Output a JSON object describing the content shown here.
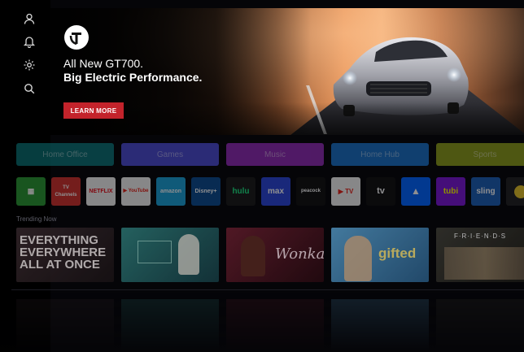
{
  "sidebar": {
    "icons": [
      "user-icon",
      "bell-icon",
      "gear-icon",
      "search-icon"
    ]
  },
  "hero": {
    "headline": "All New GT700.",
    "subheadline": "Big Electric Performance.",
    "cta_label": "LEARN MORE",
    "brand": "GT"
  },
  "categories": [
    {
      "label": "Home Office",
      "color": "#0b6f74"
    },
    {
      "label": "Games",
      "color": "#4b4ad1"
    },
    {
      "label": "Music",
      "color": "#8e2bb3"
    },
    {
      "label": "Home Hub",
      "color": "#1a6fc4"
    },
    {
      "label": "Sports",
      "color": "#8a9a1b"
    }
  ],
  "apps": [
    {
      "label": "▦",
      "name": "apps",
      "color": "#2f9b3a"
    },
    {
      "label": "TV Channels",
      "name": "watchfree",
      "color": "#d0312d"
    },
    {
      "label": "NETFLIX",
      "name": "netflix",
      "color": "#ffffff"
    },
    {
      "label": "▶ YouTube",
      "name": "youtube",
      "color": "#ffffff"
    },
    {
      "label": "amazon",
      "name": "prime-video",
      "color": "#1aa1d6"
    },
    {
      "label": "Disney+",
      "name": "disney-plus",
      "color": "#0b4b8f"
    },
    {
      "label": "hulu",
      "name": "hulu",
      "color": "#1ce783"
    },
    {
      "label": "max",
      "name": "max",
      "color": "#2a46d8"
    },
    {
      "label": "peacock",
      "name": "peacock",
      "color": "#111111"
    },
    {
      "label": "▶ TV",
      "name": "youtube-tv",
      "color": "#ffffff"
    },
    {
      "label": "tv",
      "name": "apple-tv",
      "color": "#111111"
    },
    {
      "label": "▲",
      "name": "paramount-plus",
      "color": "#0064ff"
    },
    {
      "label": "tubi",
      "name": "tubi",
      "color": "#7b16d6"
    },
    {
      "label": "sling",
      "name": "sling",
      "color": "#1c5fb5"
    },
    {
      "label": "",
      "name": "more-app",
      "color": "#e6c229"
    }
  ],
  "trending": {
    "label": "Trending Now",
    "items": [
      {
        "title": "EVERYTHING EVERYWHERE ALL AT ONCE",
        "name": "everything-everywhere"
      },
      {
        "title": "",
        "name": "show-2"
      },
      {
        "title": "",
        "name": "wonka"
      },
      {
        "title": "gifted",
        "name": "gifted"
      },
      {
        "title": "F·R·I·E·N·D·S",
        "name": "friends"
      }
    ]
  }
}
